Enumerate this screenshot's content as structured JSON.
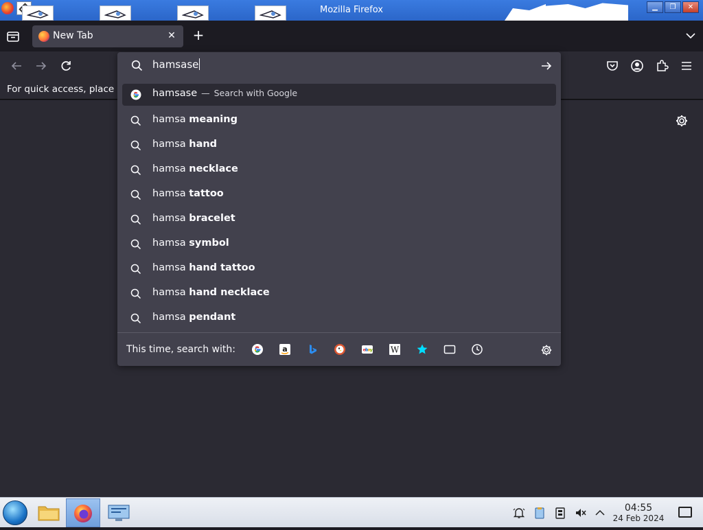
{
  "window": {
    "title": "Mozilla Firefox"
  },
  "tabs": [
    {
      "title": "New Tab",
      "favicon": "firefox-icon"
    }
  ],
  "toolbar": {
    "icons": [
      "back-icon",
      "forward-icon",
      "reload-icon",
      "pocket-icon",
      "account-icon",
      "extensions-icon",
      "menu-icon"
    ]
  },
  "bookmarks_bar": {
    "text": "For quick access, place y"
  },
  "urlbar": {
    "value": "hamsase",
    "results": [
      {
        "prefix": "hamsase",
        "bold": "",
        "action": "Search with Google",
        "icon": "google-icon",
        "selected": true
      },
      {
        "prefix": "hamsa ",
        "bold": "meaning",
        "icon": "search-icon"
      },
      {
        "prefix": "hamsa ",
        "bold": "hand",
        "icon": "search-icon"
      },
      {
        "prefix": "hamsa ",
        "bold": "necklace",
        "icon": "search-icon"
      },
      {
        "prefix": "hamsa ",
        "bold": "tattoo",
        "icon": "search-icon"
      },
      {
        "prefix": "hamsa ",
        "bold": "bracelet",
        "icon": "search-icon"
      },
      {
        "prefix": "hamsa ",
        "bold": "symbol",
        "icon": "search-icon"
      },
      {
        "prefix": "hamsa ",
        "bold": "hand tattoo",
        "icon": "search-icon"
      },
      {
        "prefix": "hamsa ",
        "bold": "hand necklace",
        "icon": "search-icon"
      },
      {
        "prefix": "hamsa ",
        "bold": "pendant",
        "icon": "search-icon"
      }
    ],
    "oneoff_label": "This time, search with:",
    "oneoff_engines": [
      "google-icon",
      "amazon-icon",
      "bing-icon",
      "duckduckgo-icon",
      "ebay-icon",
      "wikipedia-icon",
      "bookmarks-icon",
      "tabs-icon",
      "history-icon"
    ]
  },
  "taskbar": {
    "time": "04:55",
    "date": "24 Feb 2024"
  },
  "colors": {
    "toolbar": "#2b2a33",
    "popup": "#42414d",
    "tabstrip": "#1c1b22",
    "taskbar": "#dfe4ec"
  }
}
